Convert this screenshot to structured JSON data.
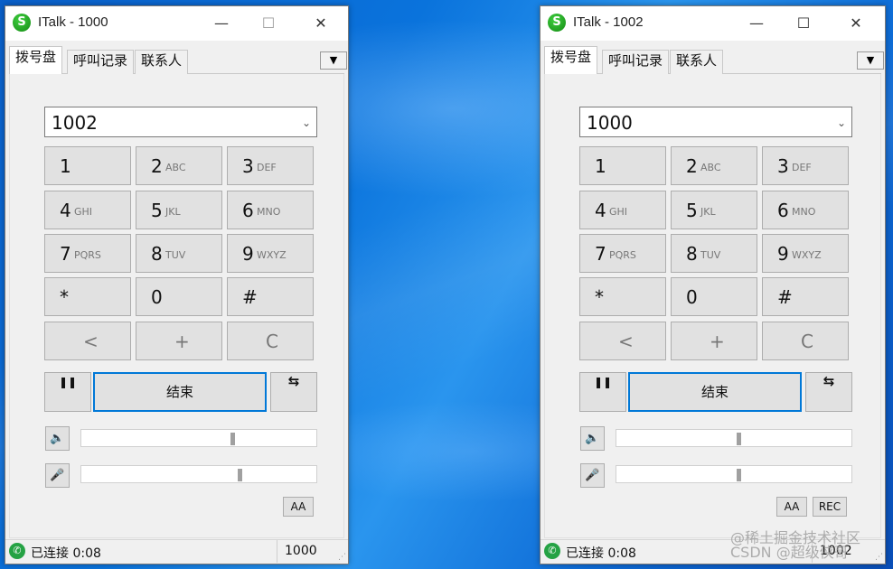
{
  "watermark": {
    "line1": "@稀土掘金技术社区",
    "line2": "CSDN @超级侠哥"
  },
  "windows": [
    {
      "title": "ITalk - 1000",
      "tabs": [
        "拨号盘",
        "呼叫记录",
        "联系人"
      ],
      "number": "1002",
      "keys": [
        {
          "d": "1",
          "l": ""
        },
        {
          "d": "2",
          "l": "ABC"
        },
        {
          "d": "3",
          "l": "DEF"
        },
        {
          "d": "4",
          "l": "GHI"
        },
        {
          "d": "5",
          "l": "JKL"
        },
        {
          "d": "6",
          "l": "MNO"
        },
        {
          "d": "7",
          "l": "PQRS"
        },
        {
          "d": "8",
          "l": "TUV"
        },
        {
          "d": "9",
          "l": "WXYZ"
        },
        {
          "d": "*",
          "l": ""
        },
        {
          "d": "0",
          "l": ""
        },
        {
          "d": "#",
          "l": ""
        }
      ],
      "syms": [
        "<",
        "+",
        "C"
      ],
      "pause": "❚❚",
      "end": "结束",
      "transfer": "⇆",
      "speaker_level": 0.64,
      "mic_level": 0.67,
      "aa": "AA",
      "status": "已连接 0:08",
      "ext": "1000"
    },
    {
      "title": "ITalk - 1002",
      "tabs": [
        "拨号盘",
        "呼叫记录",
        "联系人"
      ],
      "number": "1000",
      "keys": [
        {
          "d": "1",
          "l": ""
        },
        {
          "d": "2",
          "l": "ABC"
        },
        {
          "d": "3",
          "l": "DEF"
        },
        {
          "d": "4",
          "l": "GHI"
        },
        {
          "d": "5",
          "l": "JKL"
        },
        {
          "d": "6",
          "l": "MNO"
        },
        {
          "d": "7",
          "l": "PQRS"
        },
        {
          "d": "8",
          "l": "TUV"
        },
        {
          "d": "9",
          "l": "WXYZ"
        },
        {
          "d": "*",
          "l": ""
        },
        {
          "d": "0",
          "l": ""
        },
        {
          "d": "#",
          "l": ""
        }
      ],
      "syms": [
        "<",
        "+",
        "C"
      ],
      "pause": "❚❚",
      "end": "结束",
      "transfer": "⇆",
      "speaker_level": 0.52,
      "mic_level": 0.52,
      "aa": "AA",
      "rec": "REC",
      "status": "已连接 0:08",
      "ext": "1002"
    }
  ]
}
